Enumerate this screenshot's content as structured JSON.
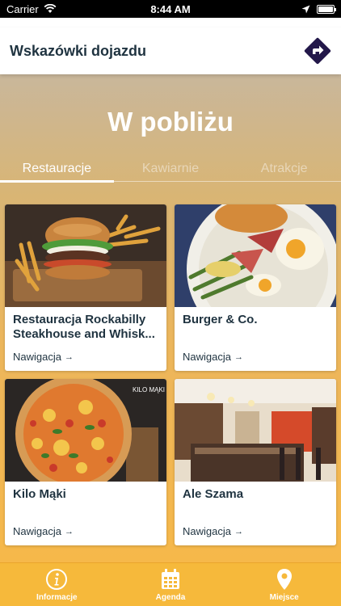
{
  "status_bar": {
    "carrier": "Carrier",
    "time": "8:44 AM",
    "battery_level": 1.0
  },
  "header": {
    "title": "Wskazówki dojazdu",
    "nav_icon": "navigation-diamond-icon"
  },
  "main": {
    "title": "W pobliżu",
    "tabs": [
      {
        "label": "Restauracje",
        "active": true
      },
      {
        "label": "Kawiarnie",
        "active": false
      },
      {
        "label": "Atrakcje",
        "active": false
      }
    ],
    "cards": [
      {
        "name": "Restauracja Rockabilly Steakhouse and Whisk...",
        "nav_label": "Nawigacja",
        "image": "burger-photo"
      },
      {
        "name": "Burger & Co.",
        "nav_label": "Nawigacja",
        "image": "breakfast-plate-photo"
      },
      {
        "name": "Kilo Mąki",
        "nav_label": "Nawigacja",
        "image": "pizza-photo",
        "image_text": "KILO MĄKI"
      },
      {
        "name": "Ale Szama",
        "nav_label": "Nawigacja",
        "image": "restaurant-interior-photo"
      }
    ]
  },
  "bottom_tabs": [
    {
      "label": "Informacje",
      "icon": "info-icon"
    },
    {
      "label": "Agenda",
      "icon": "calendar-icon"
    },
    {
      "label": "Miejsce",
      "icon": "location-pin-icon"
    }
  ],
  "colors": {
    "accent": "#f6b93b",
    "text_dark": "#1f3340",
    "nav_icon": "#23184a"
  }
}
